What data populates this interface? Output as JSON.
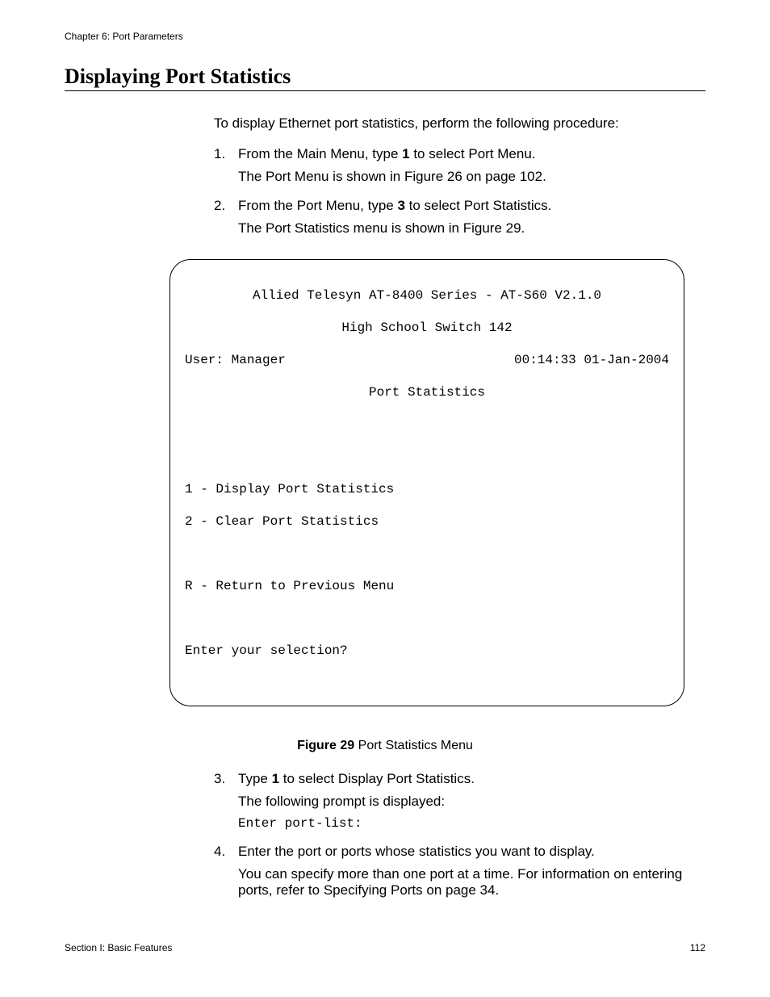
{
  "header": {
    "chapter": "Chapter 6: Port Parameters"
  },
  "title": "Displaying Port Statistics",
  "intro": "To display Ethernet port statistics, perform the following procedure:",
  "steps": {
    "s1": {
      "num": "1.",
      "text_a": "From the Main Menu, type ",
      "bold": "1",
      "text_b": " to select Port Menu.",
      "follow": "The Port Menu is shown in Figure 26 on page 102."
    },
    "s2": {
      "num": "2.",
      "text_a": "From the Port Menu, type ",
      "bold": "3",
      "text_b": " to select Port Statistics.",
      "follow": "The Port Statistics menu is shown in Figure 29."
    },
    "s3": {
      "num": "3.",
      "text_a": "Type ",
      "bold": "1",
      "text_b": " to select Display Port Statistics.",
      "follow": "The following prompt is displayed:",
      "code": "Enter port-list:"
    },
    "s4": {
      "num": "4.",
      "text": "Enter the port or ports whose statistics you want to display.",
      "follow": "You can specify more than one port at a time. For information on entering ports, refer to Specifying Ports on page 34."
    }
  },
  "terminal": {
    "line1": "Allied Telesyn AT-8400 Series - AT-S60 V2.1.0",
    "line2": "High School Switch 142",
    "user": "User: Manager",
    "datetime": "00:14:33 01-Jan-2004",
    "menu_title": "Port Statistics",
    "opt1": "1 - Display Port Statistics",
    "opt2": "2 - Clear Port Statistics",
    "optR": "R - Return to Previous Menu",
    "prompt": "Enter your selection?"
  },
  "figure": {
    "label": "Figure 29",
    "caption": "  Port Statistics Menu"
  },
  "footer": {
    "section": "Section I: Basic Features",
    "page": "112"
  }
}
